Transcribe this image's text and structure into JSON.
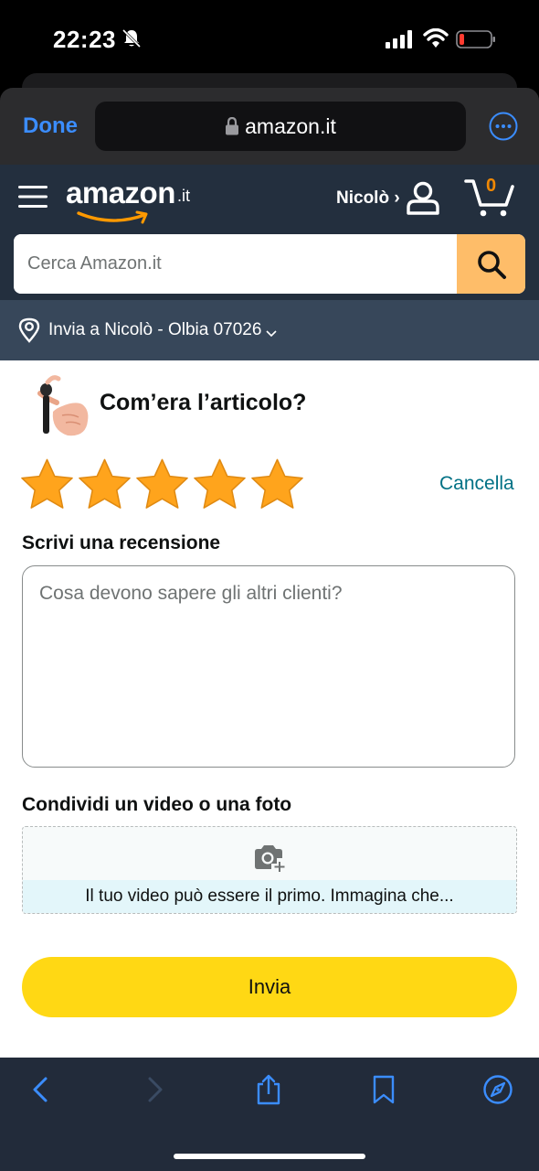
{
  "status_bar": {
    "time": "22:23",
    "icons": [
      "bell-slash-icon",
      "cellular-signal-icon",
      "wifi-icon",
      "battery-low-icon"
    ]
  },
  "browser": {
    "done_label": "Done",
    "url": "amazon.it",
    "accent": "#3b8dff"
  },
  "header": {
    "logo_text": "amazon",
    "logo_tld": ".it",
    "account_label": "Nicolò ›",
    "cart_count": "0",
    "search_placeholder": "Cerca Amazon.it",
    "search_button_color": "#febd69",
    "header_color": "#232f3e"
  },
  "delivery": {
    "text": "Invia a Nicolò - Olbia 07026"
  },
  "review": {
    "question": "Com’era l’articolo?",
    "rating": 5,
    "max_rating": 5,
    "star_color": "#ffa41c",
    "clear_label": "Cancella",
    "review_label": "Scrivi una recensione",
    "review_placeholder": "Cosa devono sapere gli altri clienti?",
    "media_label": "Condividi un video o una foto",
    "media_hint": "Il tuo video può essere il primo. Immagina che...",
    "submit_label": "Invia",
    "submit_color": "#ffd814"
  },
  "toolbar": {
    "icons": [
      "back-icon",
      "forward-icon",
      "share-icon",
      "bookmarks-icon",
      "compass-icon"
    ]
  }
}
